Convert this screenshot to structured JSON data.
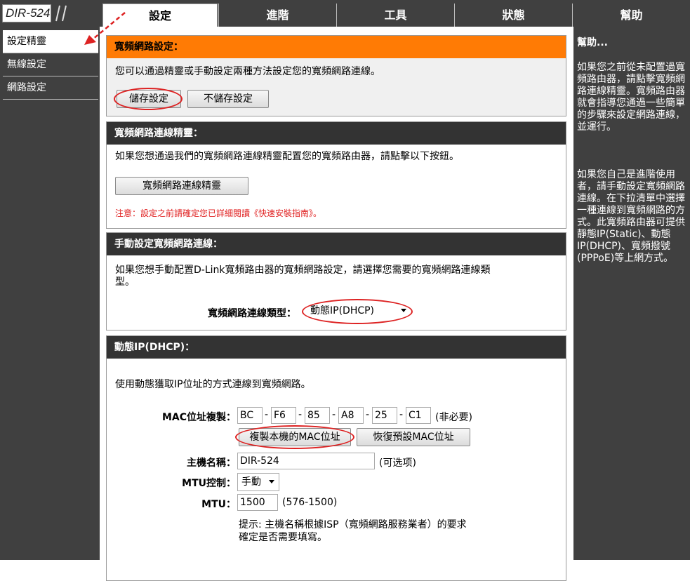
{
  "brand": {
    "logo_text": "DIR-524"
  },
  "tabs": [
    {
      "label": "設定",
      "active": true
    },
    {
      "label": "進階",
      "active": false
    },
    {
      "label": "工具",
      "active": false
    },
    {
      "label": "狀態",
      "active": false
    },
    {
      "label": "幫助",
      "active": false
    }
  ],
  "sidebar": {
    "items": [
      {
        "label": "設定精靈",
        "active": true
      },
      {
        "label": "無線設定",
        "active": false
      },
      {
        "label": "網路設定",
        "active": false
      }
    ]
  },
  "internet_setup": {
    "title": "寬頻網路設定：",
    "description": "您可以通過精靈或手動設定兩種方法設定您的寬頻網路連線。",
    "save_button": "儲存設定",
    "dont_save_button": "不儲存設定"
  },
  "wizard": {
    "title": "寬頻網路連線精靈：",
    "description": "如果您想通過我們的寬頻網路連線精靈配置您的寬頻路由器，請點擊以下按鈕。",
    "button": "寬頻網路連線精靈",
    "note": "注意：設定之前請確定您已詳細閱讀《快速安裝指南》。"
  },
  "manual": {
    "title": "手動設定寬頻網路連線：",
    "description_line1": "如果您想手動配置D-Link寬頻路由器的寬頻網路設定，請選擇您需要的寬頻網路連線類",
    "description_line2": "型。",
    "type_label": "寬頻網路連線類型：",
    "type_value": "動態IP(DHCP)"
  },
  "dhcp": {
    "title": "動態IP(DHCP)：",
    "description": "使用動態獲取IP位址的方式連線到寬頻網路。",
    "mac_label": "MAC位址複製：",
    "mac_parts": [
      "BC",
      "F6",
      "85",
      "A8",
      "25",
      "C1"
    ],
    "mac_sep": "-",
    "mac_optional": "(非必要)",
    "clone_button": "複製本機的MAC位址",
    "restore_button": "恢復預設MAC位址",
    "host_label": "主機名稱：",
    "host_value": "DIR-524",
    "host_optional": "(可选项)",
    "mtu_ctrl_label": "MTU控制：",
    "mtu_ctrl_value": "手動",
    "mtu_label": "MTU：",
    "mtu_value": "1500",
    "mtu_range": "(576-1500)",
    "hint_line1": "提示: 主機名稱根據ISP（寬頻網路服務業者）的要求",
    "hint_line2": "確定是否需要填寫。"
  },
  "help": {
    "title": "幫助...",
    "para1": "如果您之前從未配置過寬頻路由器，請點擊寬頻網路連線精靈。寬頻路由器就會指導您通過一些簡單的步驟來設定網路連線，並運行。",
    "para2": "如果您自己是進階使用者，請手動設定寬頻網路連線。在下拉清單中選擇一種連線到寬頻網路的方式。此寬頻路由器可提供靜態IP(Static)、動態IP(DHCP)、寬頻撥號(PPPoE)等上網方式。"
  },
  "colors": {
    "header_orange": "#ff7b05",
    "annotation_red": "#d22222",
    "frame_dark": "#404040"
  }
}
